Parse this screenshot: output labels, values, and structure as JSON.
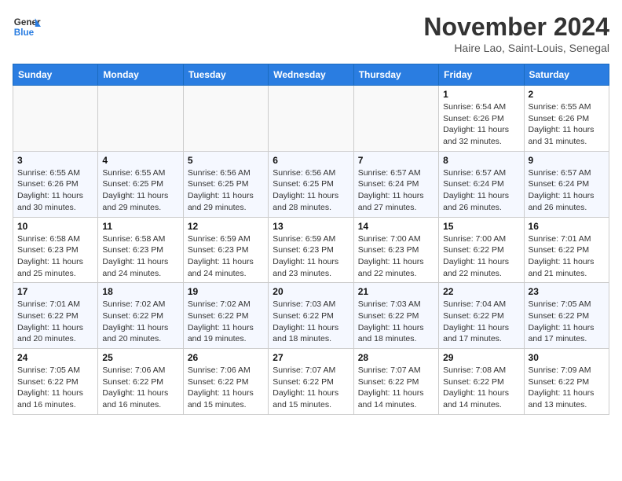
{
  "logo": {
    "line1": "General",
    "line2": "Blue"
  },
  "title": "November 2024",
  "location": "Haire Lao, Saint-Louis, Senegal",
  "days_of_week": [
    "Sunday",
    "Monday",
    "Tuesday",
    "Wednesday",
    "Thursday",
    "Friday",
    "Saturday"
  ],
  "weeks": [
    [
      {
        "day": "",
        "info": ""
      },
      {
        "day": "",
        "info": ""
      },
      {
        "day": "",
        "info": ""
      },
      {
        "day": "",
        "info": ""
      },
      {
        "day": "",
        "info": ""
      },
      {
        "day": "1",
        "info": "Sunrise: 6:54 AM\nSunset: 6:26 PM\nDaylight: 11 hours and 32 minutes."
      },
      {
        "day": "2",
        "info": "Sunrise: 6:55 AM\nSunset: 6:26 PM\nDaylight: 11 hours and 31 minutes."
      }
    ],
    [
      {
        "day": "3",
        "info": "Sunrise: 6:55 AM\nSunset: 6:26 PM\nDaylight: 11 hours and 30 minutes."
      },
      {
        "day": "4",
        "info": "Sunrise: 6:55 AM\nSunset: 6:25 PM\nDaylight: 11 hours and 29 minutes."
      },
      {
        "day": "5",
        "info": "Sunrise: 6:56 AM\nSunset: 6:25 PM\nDaylight: 11 hours and 29 minutes."
      },
      {
        "day": "6",
        "info": "Sunrise: 6:56 AM\nSunset: 6:25 PM\nDaylight: 11 hours and 28 minutes."
      },
      {
        "day": "7",
        "info": "Sunrise: 6:57 AM\nSunset: 6:24 PM\nDaylight: 11 hours and 27 minutes."
      },
      {
        "day": "8",
        "info": "Sunrise: 6:57 AM\nSunset: 6:24 PM\nDaylight: 11 hours and 26 minutes."
      },
      {
        "day": "9",
        "info": "Sunrise: 6:57 AM\nSunset: 6:24 PM\nDaylight: 11 hours and 26 minutes."
      }
    ],
    [
      {
        "day": "10",
        "info": "Sunrise: 6:58 AM\nSunset: 6:23 PM\nDaylight: 11 hours and 25 minutes."
      },
      {
        "day": "11",
        "info": "Sunrise: 6:58 AM\nSunset: 6:23 PM\nDaylight: 11 hours and 24 minutes."
      },
      {
        "day": "12",
        "info": "Sunrise: 6:59 AM\nSunset: 6:23 PM\nDaylight: 11 hours and 24 minutes."
      },
      {
        "day": "13",
        "info": "Sunrise: 6:59 AM\nSunset: 6:23 PM\nDaylight: 11 hours and 23 minutes."
      },
      {
        "day": "14",
        "info": "Sunrise: 7:00 AM\nSunset: 6:23 PM\nDaylight: 11 hours and 22 minutes."
      },
      {
        "day": "15",
        "info": "Sunrise: 7:00 AM\nSunset: 6:22 PM\nDaylight: 11 hours and 22 minutes."
      },
      {
        "day": "16",
        "info": "Sunrise: 7:01 AM\nSunset: 6:22 PM\nDaylight: 11 hours and 21 minutes."
      }
    ],
    [
      {
        "day": "17",
        "info": "Sunrise: 7:01 AM\nSunset: 6:22 PM\nDaylight: 11 hours and 20 minutes."
      },
      {
        "day": "18",
        "info": "Sunrise: 7:02 AM\nSunset: 6:22 PM\nDaylight: 11 hours and 20 minutes."
      },
      {
        "day": "19",
        "info": "Sunrise: 7:02 AM\nSunset: 6:22 PM\nDaylight: 11 hours and 19 minutes."
      },
      {
        "day": "20",
        "info": "Sunrise: 7:03 AM\nSunset: 6:22 PM\nDaylight: 11 hours and 18 minutes."
      },
      {
        "day": "21",
        "info": "Sunrise: 7:03 AM\nSunset: 6:22 PM\nDaylight: 11 hours and 18 minutes."
      },
      {
        "day": "22",
        "info": "Sunrise: 7:04 AM\nSunset: 6:22 PM\nDaylight: 11 hours and 17 minutes."
      },
      {
        "day": "23",
        "info": "Sunrise: 7:05 AM\nSunset: 6:22 PM\nDaylight: 11 hours and 17 minutes."
      }
    ],
    [
      {
        "day": "24",
        "info": "Sunrise: 7:05 AM\nSunset: 6:22 PM\nDaylight: 11 hours and 16 minutes."
      },
      {
        "day": "25",
        "info": "Sunrise: 7:06 AM\nSunset: 6:22 PM\nDaylight: 11 hours and 16 minutes."
      },
      {
        "day": "26",
        "info": "Sunrise: 7:06 AM\nSunset: 6:22 PM\nDaylight: 11 hours and 15 minutes."
      },
      {
        "day": "27",
        "info": "Sunrise: 7:07 AM\nSunset: 6:22 PM\nDaylight: 11 hours and 15 minutes."
      },
      {
        "day": "28",
        "info": "Sunrise: 7:07 AM\nSunset: 6:22 PM\nDaylight: 11 hours and 14 minutes."
      },
      {
        "day": "29",
        "info": "Sunrise: 7:08 AM\nSunset: 6:22 PM\nDaylight: 11 hours and 14 minutes."
      },
      {
        "day": "30",
        "info": "Sunrise: 7:09 AM\nSunset: 6:22 PM\nDaylight: 11 hours and 13 minutes."
      }
    ]
  ]
}
